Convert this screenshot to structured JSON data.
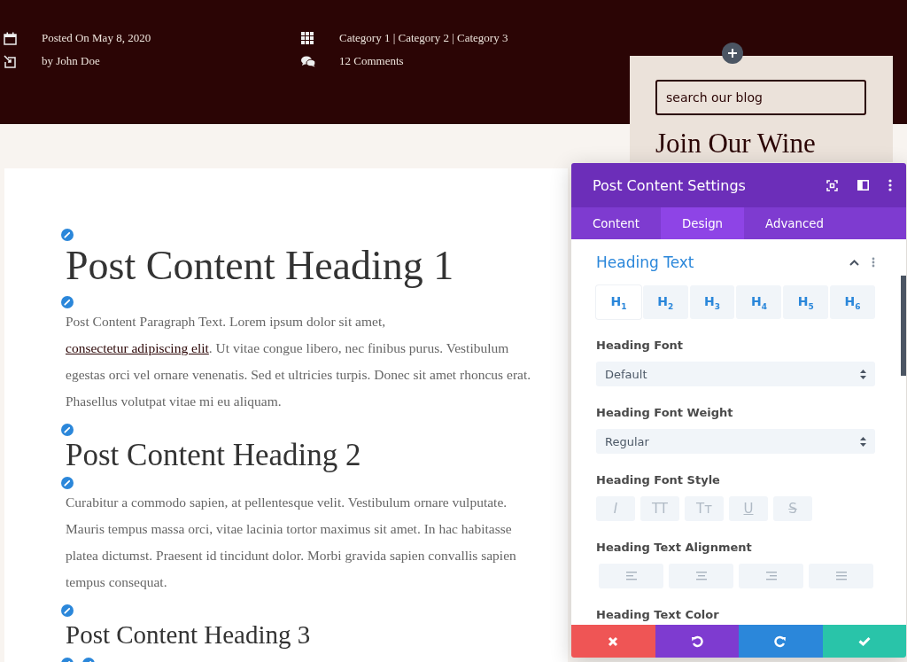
{
  "meta": [
    {
      "kind": "calendar",
      "text": "Posted On May 8, 2020"
    },
    {
      "kind": "categories",
      "text": "Category 1 | Category 2 | Category 3"
    },
    {
      "kind": "author",
      "text": "by John Doe"
    },
    {
      "kind": "comments",
      "text": "12 Comments"
    }
  ],
  "article": {
    "blocks": [
      {
        "kind": "h1",
        "text": "Post Content Heading 1"
      },
      {
        "kind": "paragraph",
        "parts": [
          {
            "text": "Post Content Paragraph Text. Lorem ipsum dolor sit amet, ",
            "link": false
          },
          {
            "text": "consectetur adipiscing elit",
            "link": true
          },
          {
            "text": ". Ut vitae congue libero, nec finibus purus. Vestibulum egestas orci vel ornare venenatis. Sed et ultricies turpis. Donec sit amet rhoncus erat. Phasellus volutpat vitae mi eu aliquam.",
            "link": false
          }
        ]
      },
      {
        "kind": "h2",
        "text": "Post Content Heading 2"
      },
      {
        "kind": "paragraph",
        "parts": [
          {
            "text": "Curabitur a commodo sapien, at pellentesque velit. Vestibulum ornare vulputate. Mauris tempus massa orci, vitae lacinia tortor maximus sit amet. In hac habitasse platea dictumst. Praesent id tincidunt dolor. Morbi gravida sapien convallis sapien tempus consequat.",
            "link": false
          }
        ]
      },
      {
        "kind": "h3",
        "text": "Post Content Heading 3"
      }
    ]
  },
  "sidebar": {
    "search": {
      "placeholder": "search our blog"
    },
    "title": "Join Our Wine"
  },
  "panel": {
    "title": "Post Content Settings",
    "tabs": [
      {
        "label": "Content",
        "selected": false
      },
      {
        "label": "Design",
        "selected": true
      },
      {
        "label": "Advanced",
        "selected": false
      }
    ],
    "section": {
      "title": "Heading Text",
      "expanded": true
    },
    "heading_tabs": [
      {
        "label": "H$_{1}$",
        "selected": true
      },
      {
        "label": "H$_{2}$",
        "selected": false
      },
      {
        "label": "H$_{3}$",
        "selected": false
      },
      {
        "label": "H$_{4}$",
        "selected": false
      },
      {
        "label": "H$_{5}$",
        "selected": false
      },
      {
        "label": "H$_{6}$",
        "selected": false
      }
    ],
    "fields": [
      {
        "kind": "select",
        "label": "Heading Font",
        "value": "Default"
      },
      {
        "kind": "select",
        "label": "Heading Font Weight",
        "value": "Regular"
      },
      {
        "kind": "style_buttons",
        "label": "Heading Font Style",
        "buttons": [
          {
            "kind": "italic",
            "label": "I"
          },
          {
            "kind": "uppercase",
            "label": "TT"
          },
          {
            "kind": "capitalize",
            "label": "Tᴛ"
          },
          {
            "kind": "underline",
            "label": "U"
          },
          {
            "kind": "strike",
            "label": "S"
          }
        ]
      },
      {
        "kind": "align_buttons",
        "label": "Heading Text Alignment",
        "buttons": [
          {
            "kind": "left"
          },
          {
            "kind": "center"
          },
          {
            "kind": "right"
          },
          {
            "kind": "justify"
          }
        ]
      },
      {
        "kind": "color",
        "label": "Heading Text Color"
      }
    ],
    "actions": [
      {
        "kind": "cancel"
      },
      {
        "kind": "undo"
      },
      {
        "kind": "redo"
      },
      {
        "kind": "save"
      }
    ]
  }
}
